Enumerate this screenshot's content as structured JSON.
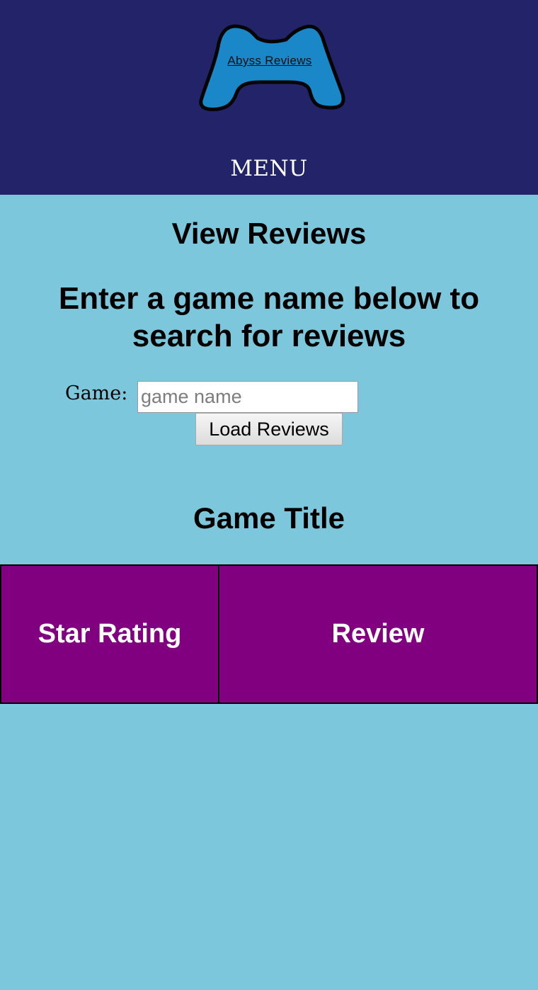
{
  "header": {
    "logo_text": "Abyss Reviews",
    "menu_label": "MENU",
    "background_color": "#222368",
    "logo_fill_color": "#1a87c8"
  },
  "main": {
    "page_title": "View Reviews",
    "instructions": "Enter a game name below to search for reviews",
    "search": {
      "label": "Game:",
      "placeholder": "game name",
      "value": ""
    },
    "load_button_label": "Load Reviews",
    "game_title": "Game Title",
    "background_color": "#7cc7dc"
  },
  "reviews_table": {
    "columns": [
      "Star Rating",
      "Review"
    ],
    "rows": [],
    "header_color": "#800080"
  }
}
